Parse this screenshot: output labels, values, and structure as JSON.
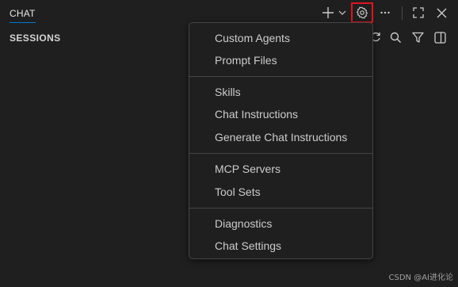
{
  "header": {
    "tab_label": "CHAT",
    "sessions_title": "SESSIONS"
  },
  "toolbar": {
    "icons": [
      "plus-icon",
      "chevron-down-icon",
      "gear-icon",
      "more-icon",
      "maximize-icon",
      "close-icon"
    ],
    "highlight_color": "#e0141e"
  },
  "sessions_toolbar": {
    "icons": [
      "refresh-icon",
      "search-icon",
      "filter-icon",
      "split-view-icon"
    ]
  },
  "menu": {
    "groups": [
      [
        "Custom Agents",
        "Prompt Files"
      ],
      [
        "Skills",
        "Chat Instructions",
        "Generate Chat Instructions"
      ],
      [
        "MCP Servers",
        "Tool Sets"
      ],
      [
        "Diagnostics",
        "Chat Settings"
      ]
    ],
    "custom_agents": "Custom Agents",
    "prompt_files": "Prompt Files",
    "skills": "Skills",
    "chat_instructions": "Chat Instructions",
    "generate_chat_instructions": "Generate Chat Instructions",
    "mcp_servers": "MCP Servers",
    "tool_sets": "Tool Sets",
    "diagnostics": "Diagnostics",
    "chat_settings": "Chat Settings"
  },
  "watermark": "CSDN @AI进化论",
  "colors": {
    "background": "#1f1f1f",
    "accent": "#0078d4",
    "text": "#cccccc"
  }
}
